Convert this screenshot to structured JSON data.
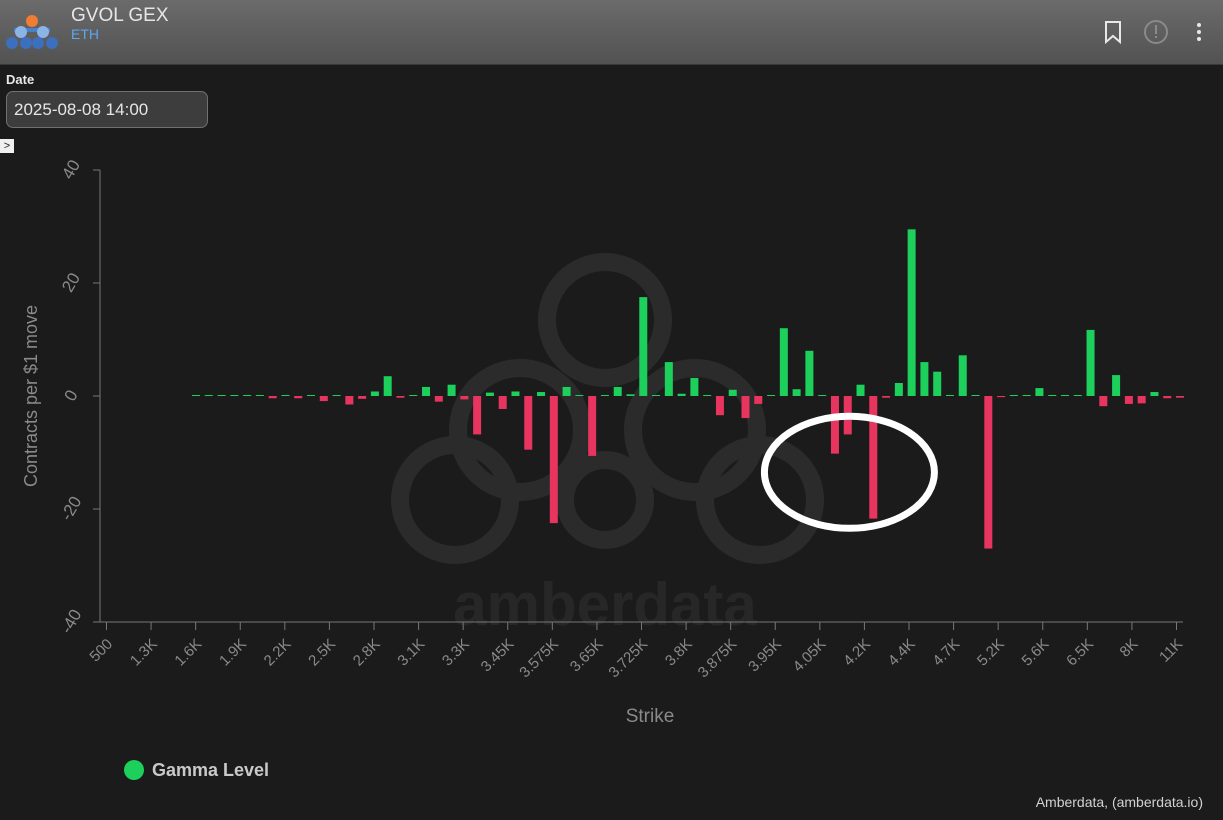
{
  "header": {
    "title": "GVOL GEX",
    "subtitle": "ETH"
  },
  "date": {
    "label": "Date",
    "value": "2025-08-08 14:00"
  },
  "expand_icon": "chevron-right-icon",
  "watermark": "amberdata",
  "legend": {
    "label": "Gamma Level"
  },
  "credit": "Amberdata, (amberdata.io)",
  "colors": {
    "positive": "#1dd05c",
    "negative": "#e8355f",
    "background": "#1b1b1b",
    "axis": "#777777",
    "annotation": "#ffffff"
  },
  "chart_data": {
    "type": "bar",
    "title": "",
    "xlabel": "Strike",
    "ylabel": "Contracts per $1 move",
    "ylim": [
      -40,
      40
    ],
    "yticks": [
      40,
      20,
      0,
      -20,
      -40
    ],
    "grid": false,
    "legend_position": "bottom-left",
    "tick_labels": [
      "500",
      "1.3K",
      "1.6K",
      "1.9K",
      "2.2K",
      "2.5K",
      "2.8K",
      "3.1K",
      "3.3K",
      "3.45K",
      "3.575K",
      "3.65K",
      "3.725K",
      "3.8K",
      "3.875K",
      "3.95K",
      "4.05K",
      "4.2K",
      "4.4K",
      "4.7K",
      "5.2K",
      "5.6K",
      "6.5K",
      "8K",
      "11K"
    ],
    "series": [
      {
        "name": "Gamma Level",
        "values": [
          0,
          0,
          0,
          0,
          0,
          0,
          -0.4,
          0,
          -0.4,
          0,
          -0.9,
          0,
          -1.5,
          -0.5,
          0.8,
          3.5,
          -0.3,
          0,
          1.6,
          -1.0,
          2.0,
          -0.6,
          -6.8,
          0.6,
          -2.3,
          0.8,
          -9.5,
          0.7,
          -22.5,
          1.6,
          0,
          -10.6,
          0,
          1.6,
          0.3,
          17.5,
          0,
          6.0,
          0.4,
          3.2,
          0,
          -3.4,
          1.1,
          -3.9,
          -1.4,
          0,
          12.0,
          1.2,
          8.0,
          0,
          -10.2,
          -6.8,
          2.0,
          -21.7,
          -0.3,
          2.3,
          29.5,
          6.0,
          4.3,
          0,
          7.2,
          0,
          -27.0,
          -0.2,
          0,
          0,
          1.4,
          0,
          0,
          0,
          11.7,
          -1.8,
          3.7,
          -1.4,
          -1.3,
          0.7,
          -0.4,
          -0.3
        ]
      }
    ],
    "annotations": [
      {
        "type": "ellipse",
        "around_strike": "4.2K"
      }
    ]
  }
}
